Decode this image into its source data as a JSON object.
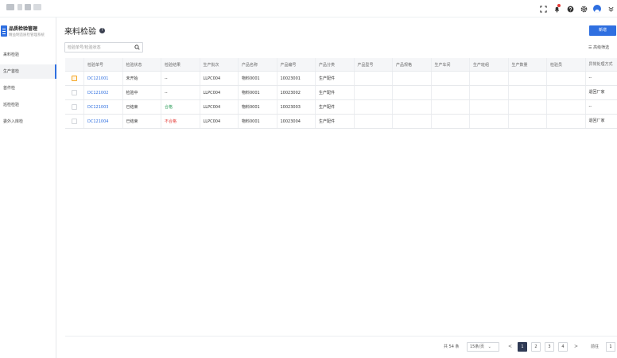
{
  "sidebar": {
    "brand": "品质检验管理",
    "brand_sub": "精益制造质检管理系统",
    "items": [
      {
        "label": "来料检验"
      },
      {
        "label": "生产首检"
      },
      {
        "label": "首件检"
      },
      {
        "label": "巡检检验"
      },
      {
        "label": "委外入库检"
      }
    ]
  },
  "page": {
    "title": "来料检验",
    "new_button": "新增",
    "search_placeholder": "检验单号/检验状态",
    "filter_label": "高级筛选"
  },
  "table": {
    "headers": [
      "检验单号",
      "检验状态",
      "检验结果",
      "生产批次",
      "产品名称",
      "产品编号",
      "产品分类",
      "产品型号",
      "产品规格",
      "生产车间",
      "生产班组",
      "生产数量",
      "检验员",
      "异常处理方式"
    ],
    "rows": [
      {
        "id": "DC121001",
        "status": "未开始",
        "result": "--",
        "batch": "LLPC004",
        "name": "物料0001",
        "code": "10023001",
        "category": "生产配件",
        "model": "",
        "spec": "",
        "workshop": "",
        "team": "",
        "qty": "",
        "inspector": "",
        "handling": "--"
      },
      {
        "id": "DC121002",
        "status": "检验中",
        "result": "--",
        "batch": "LLPC004",
        "name": "物料0001",
        "code": "10023002",
        "category": "生产配件",
        "model": "",
        "spec": "",
        "workshop": "",
        "team": "",
        "qty": "",
        "inspector": "",
        "handling": "退回厂家"
      },
      {
        "id": "DC121003",
        "status": "已结束",
        "result": "合格",
        "batch": "LLPC004",
        "name": "物料0001",
        "code": "10023003",
        "category": "生产配件",
        "model": "",
        "spec": "",
        "workshop": "",
        "team": "",
        "qty": "",
        "inspector": "",
        "handling": "--"
      },
      {
        "id": "DC121004",
        "status": "已结束",
        "result": "不合格",
        "batch": "LLPC004",
        "name": "物料0001",
        "code": "10023004",
        "category": "生产配件",
        "model": "",
        "spec": "",
        "workshop": "",
        "team": "",
        "qty": "",
        "inspector": "",
        "handling": "退回厂家"
      }
    ]
  },
  "pagination": {
    "total": "共 54 条",
    "page_size": "15条/页",
    "pages": [
      "1",
      "2",
      "3",
      "4"
    ],
    "prev": "<",
    "next": ">",
    "goto_label": "前往",
    "goto_value": "1",
    "goto_suffix": "页"
  },
  "colors": {
    "primary": "#2f6fe0",
    "success": "#2e9d5b",
    "danger": "#e53935",
    "warning": "#f5a623"
  }
}
